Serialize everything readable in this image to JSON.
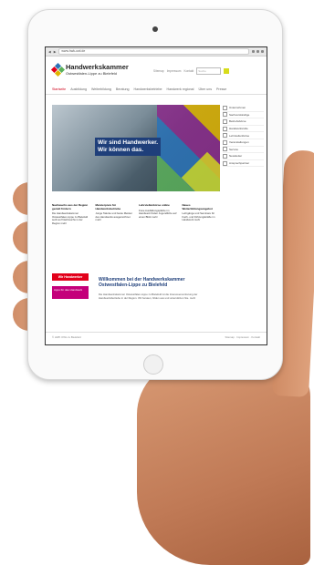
{
  "browser": {
    "url": "www.hwk-owl.de"
  },
  "site": {
    "title": "Handwerkskammer",
    "subtitle": "Ostwestfalen-Lippe zu Bielefeld",
    "utility_links": [
      "Sitemap",
      "Impressum",
      "Kontakt"
    ],
    "search_placeholder": "Suche",
    "colors": {
      "accent_red": "#d0021b",
      "brand_blue": "#1f3f7a",
      "lime": "#d7dc1a",
      "magenta": "#c4007a"
    }
  },
  "nav": [
    "Startseite",
    "Ausbildung",
    "Weiterbildung",
    "Beratung",
    "Handwerksbetriebe",
    "Handwerk regional",
    "Über uns",
    "Presse"
  ],
  "hero": {
    "line1": "Wir sind Handwerker.",
    "line2": "Wir können das."
  },
  "sidebar": [
    "Unternehmen",
    "Sachverständige",
    "Betriebsbörse",
    "Handwerksrolle",
    "Lehrstellenbörse",
    "Veranstaltungen",
    "Service",
    "Newsletter",
    "Ansprechpartner"
  ],
  "news": [
    {
      "title": "Nachwuchs aus der Region gezielt fördern",
      "text": "Die Handwerkskammer Ostwestfalen-Lippe zu Bielefeld setzt auf Nachwuchs in der Region mehr"
    },
    {
      "title": "Meisterpreis für Handwerksbetriebe",
      "text": "Junge Talente und beste Meister des Handwerks ausgezeichnet mehr"
    },
    {
      "title": "Lehrstellenbörse online",
      "text": "Freie Ausbildungsplätze im Handwerk finden Jugendliche auf einen Blick mehr"
    },
    {
      "title": "Neues Weiterbildungsangebot",
      "text": "Lehrgänge und Seminare für Fach- und Führungskräfte im Handwerk mehr"
    }
  ],
  "badges": {
    "red": "Wir Handwerker",
    "pink": "Apps für das Handwerk"
  },
  "welcome": {
    "title": "Willkommen bei der Handwerkskammer Ostwestfalen-Lippe zu Bielefeld",
    "text": "Die Handwerkskammer Ostwestfalen-Lippe zu Bielefeld ist die Interessenvertretung der Handwerksbetriebe in der Region. Wir beraten, bilden aus und unterstützen Sie. mehr"
  },
  "footer": {
    "left": "© HWK OWL zu Bielefeld",
    "right": "Sitemap · Impressum · Kontakt"
  }
}
